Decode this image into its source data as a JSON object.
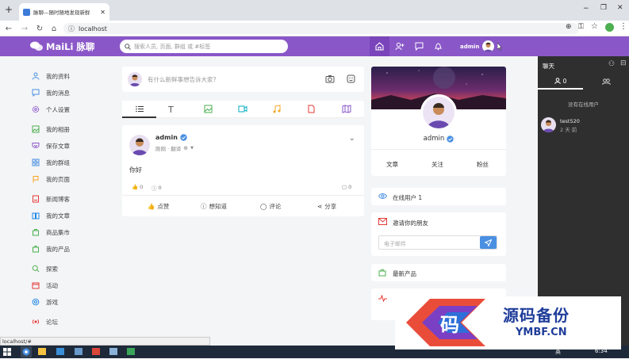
{
  "browser": {
    "tab_title": "脉聊—随时随地发现新鲜",
    "url": "localhost",
    "status_url": "localhost/#"
  },
  "header": {
    "logo_text": "MaiLi 脉聊",
    "search_placeholder": "搜索人员, 页面, 群组 或 #标签",
    "username": "admin",
    "accent": "#8a57c8"
  },
  "sidebar": {
    "items": [
      {
        "label": "我的资料",
        "icon": "user-icon",
        "color": "#4a90e2"
      },
      {
        "label": "我的消息",
        "icon": "message-icon",
        "color": "#4a90e2"
      },
      {
        "label": "个人设置",
        "icon": "gear-icon",
        "color": "#8a57c8"
      },
      {
        "label": "我的相册",
        "icon": "image-icon",
        "color": "#4caf50"
      },
      {
        "label": "保存文章",
        "icon": "bookmark-icon",
        "color": "#8a57c8"
      },
      {
        "label": "我的群组",
        "icon": "grid-icon",
        "color": "#4a90e2"
      },
      {
        "label": "我的页面",
        "icon": "flag-icon",
        "color": "#f5a623"
      },
      {
        "label": "新闻博客",
        "icon": "news-icon",
        "color": "#e53935"
      },
      {
        "label": "我的文章",
        "icon": "book-icon",
        "color": "#1e88e5"
      },
      {
        "label": "商品集市",
        "icon": "store-icon",
        "color": "#4caf50"
      },
      {
        "label": "我的产品",
        "icon": "bag-icon",
        "color": "#4caf50"
      },
      {
        "label": "探索",
        "icon": "explore-icon",
        "color": "#4caf50"
      },
      {
        "label": "活动",
        "icon": "calendar-icon",
        "color": "#e53935"
      },
      {
        "label": "游戏",
        "icon": "game-icon",
        "color": "#1e88e5"
      },
      {
        "label": "论坛",
        "icon": "forum-icon",
        "color": "#e53935"
      }
    ]
  },
  "composer": {
    "placeholder": "有什么新鲜事想告诉大家?"
  },
  "post": {
    "author": "admin",
    "meta": "刚刚 · 翻译",
    "content": "你好",
    "reactions": "0",
    "views": "0",
    "comments": "0",
    "actions": [
      "点赞",
      "想知道",
      "评论",
      "分享"
    ]
  },
  "profile": {
    "name": "admin",
    "links": [
      "文章",
      "关注",
      "粉丝"
    ]
  },
  "widgets": {
    "online": "在线用户 1",
    "invite_title": "邀请你的朋友",
    "invite_placeholder": "电子邮件",
    "latest_products": "最新产品"
  },
  "chat": {
    "title": "聊天",
    "online_count": "0",
    "no_online": "没有在线用户",
    "contact_name": "test520",
    "contact_time": "2 天 前"
  },
  "taskbar": {
    "ime": "英",
    "time": "6:34"
  },
  "watermark": {
    "title": "源码备份",
    "subtitle": "YMBF.CN",
    "glyph": "码"
  }
}
